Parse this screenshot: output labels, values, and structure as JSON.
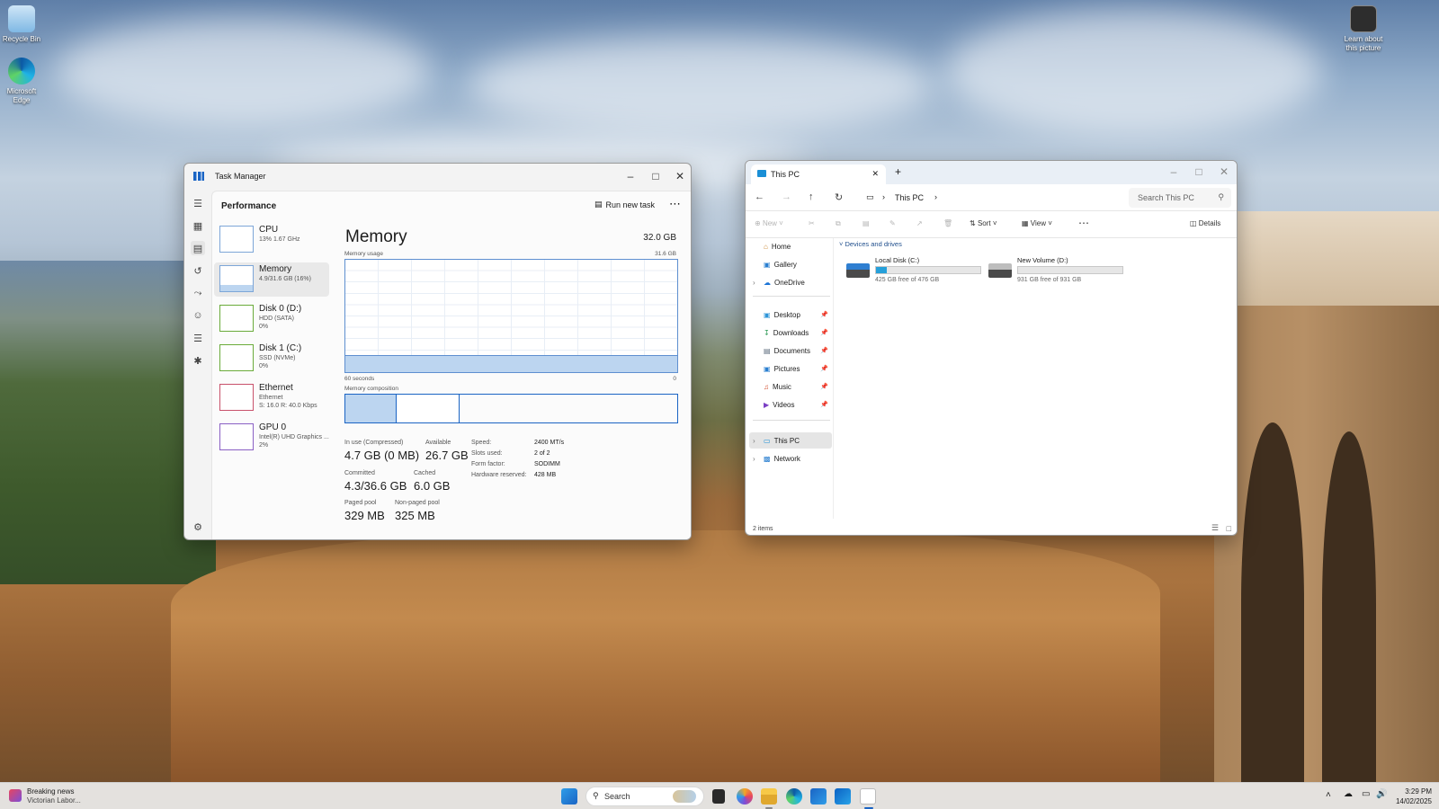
{
  "desktop": {
    "icons": [
      {
        "label": "Recycle Bin"
      },
      {
        "label": "Microsoft Edge"
      }
    ],
    "learn_picture": {
      "label": "Learn about this picture"
    }
  },
  "task_manager": {
    "title": "Task Manager",
    "section": "Performance",
    "run_new_task": "Run new task",
    "more": "⋯",
    "list": [
      {
        "name": "CPU",
        "sub1": "13%  1.67 GHz",
        "sub2": ""
      },
      {
        "name": "Memory",
        "sub1": "4.9/31.6 GB (16%)",
        "sub2": ""
      },
      {
        "name": "Disk 0 (D:)",
        "sub1": "HDD (SATA)",
        "sub2": "0%"
      },
      {
        "name": "Disk 1 (C:)",
        "sub1": "SSD (NVMe)",
        "sub2": "0%"
      },
      {
        "name": "Ethernet",
        "sub1": "Ethernet",
        "sub2": "S: 16.0  R: 40.0 Kbps"
      },
      {
        "name": "GPU 0",
        "sub1": "Intel(R) UHD Graphics ...",
        "sub2": "2%"
      }
    ],
    "detail": {
      "heading": "Memory",
      "total": "32.0 GB",
      "usage_label": "Memory usage",
      "usage_max": "31.6 GB",
      "time_left": "60 seconds",
      "time_right": "0",
      "composition_label": "Memory composition",
      "usage_fraction": 0.155,
      "stats": {
        "in_use_label": "In use (Compressed)",
        "in_use": "4.7 GB (0 MB)",
        "available_label": "Available",
        "available": "26.7 GB",
        "committed_label": "Committed",
        "committed": "4.3/36.6 GB",
        "cached_label": "Cached",
        "cached": "6.0 GB",
        "paged_label": "Paged pool",
        "paged": "329 MB",
        "nonpaged_label": "Non-paged pool",
        "nonpaged": "325 MB"
      },
      "kv": [
        {
          "label": "Speed:",
          "value": "2400 MT/s"
        },
        {
          "label": "Slots used:",
          "value": "2 of 2"
        },
        {
          "label": "Form factor:",
          "value": "SODIMM"
        },
        {
          "label": "Hardware reserved:",
          "value": "428 MB"
        }
      ]
    }
  },
  "explorer": {
    "tab_title": "This PC",
    "new_tab": "+",
    "breadcrumb": "This PC",
    "search_placeholder": "Search This PC",
    "commands": {
      "new": "New",
      "sort": "Sort",
      "view": "View",
      "more": "⋯",
      "details": "Details"
    },
    "nav": [
      {
        "label": "Home"
      },
      {
        "label": "Gallery"
      },
      {
        "label": "OneDrive"
      },
      {
        "label": "Desktop"
      },
      {
        "label": "Downloads"
      },
      {
        "label": "Documents"
      },
      {
        "label": "Pictures"
      },
      {
        "label": "Music"
      },
      {
        "label": "Videos"
      },
      {
        "label": "This PC"
      },
      {
        "label": "Network"
      }
    ],
    "group_header": "Devices and drives",
    "drives": [
      {
        "name": "Local Disk (C:)",
        "free": "425 GB free of 476 GB",
        "used_fraction": 0.107
      },
      {
        "name": "New Volume (D:)",
        "free": "931 GB free of 931 GB",
        "used_fraction": 0.0
      }
    ],
    "status": "2 items"
  },
  "taskbar": {
    "news_title": "Breaking news",
    "news_sub": "Victorian Labor...",
    "search": "Search",
    "time": "3:29 PM",
    "date": "14/02/2025"
  },
  "colors": {
    "accent": "#1a64c4",
    "memory_fill": "#bcd5f0",
    "disk_bar": "#26a0da"
  }
}
